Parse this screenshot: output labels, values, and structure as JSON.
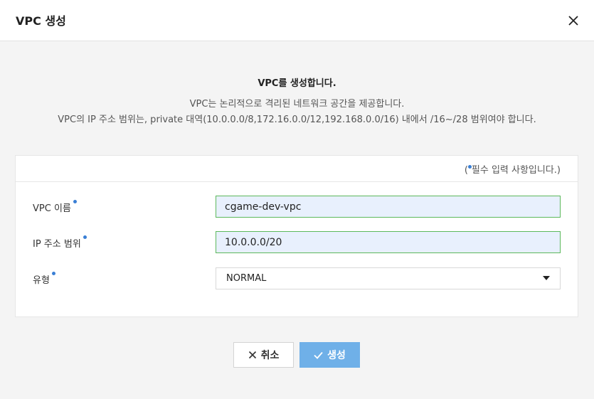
{
  "dialog": {
    "title": "VPC 생성"
  },
  "intro": {
    "heading": "VPC를 생성합니다.",
    "line1": "VPC는 논리적으로 격리된 네트워크 공간을 제공합니다.",
    "line2": "VPC의 IP 주소 범위는, private 대역(10.0.0.0/8,172.16.0.0/12,192.168.0.0/16) 내에서 /16~/28 범위여야 합니다."
  },
  "form": {
    "required_open": "(",
    "required_note": "필수 입력 사항입니다.)",
    "fields": [
      {
        "label": "VPC 이름",
        "value": "cgame-dev-vpc"
      },
      {
        "label": "IP 주소 범위",
        "value": "10.0.0.0/20"
      },
      {
        "label": "유형",
        "value": "NORMAL"
      }
    ]
  },
  "buttons": {
    "cancel": "취소",
    "create": "생성"
  },
  "colors": {
    "required_dot": "#3a7fd5",
    "valid_border": "#5cb85c",
    "primary": "#6fb0e8"
  }
}
